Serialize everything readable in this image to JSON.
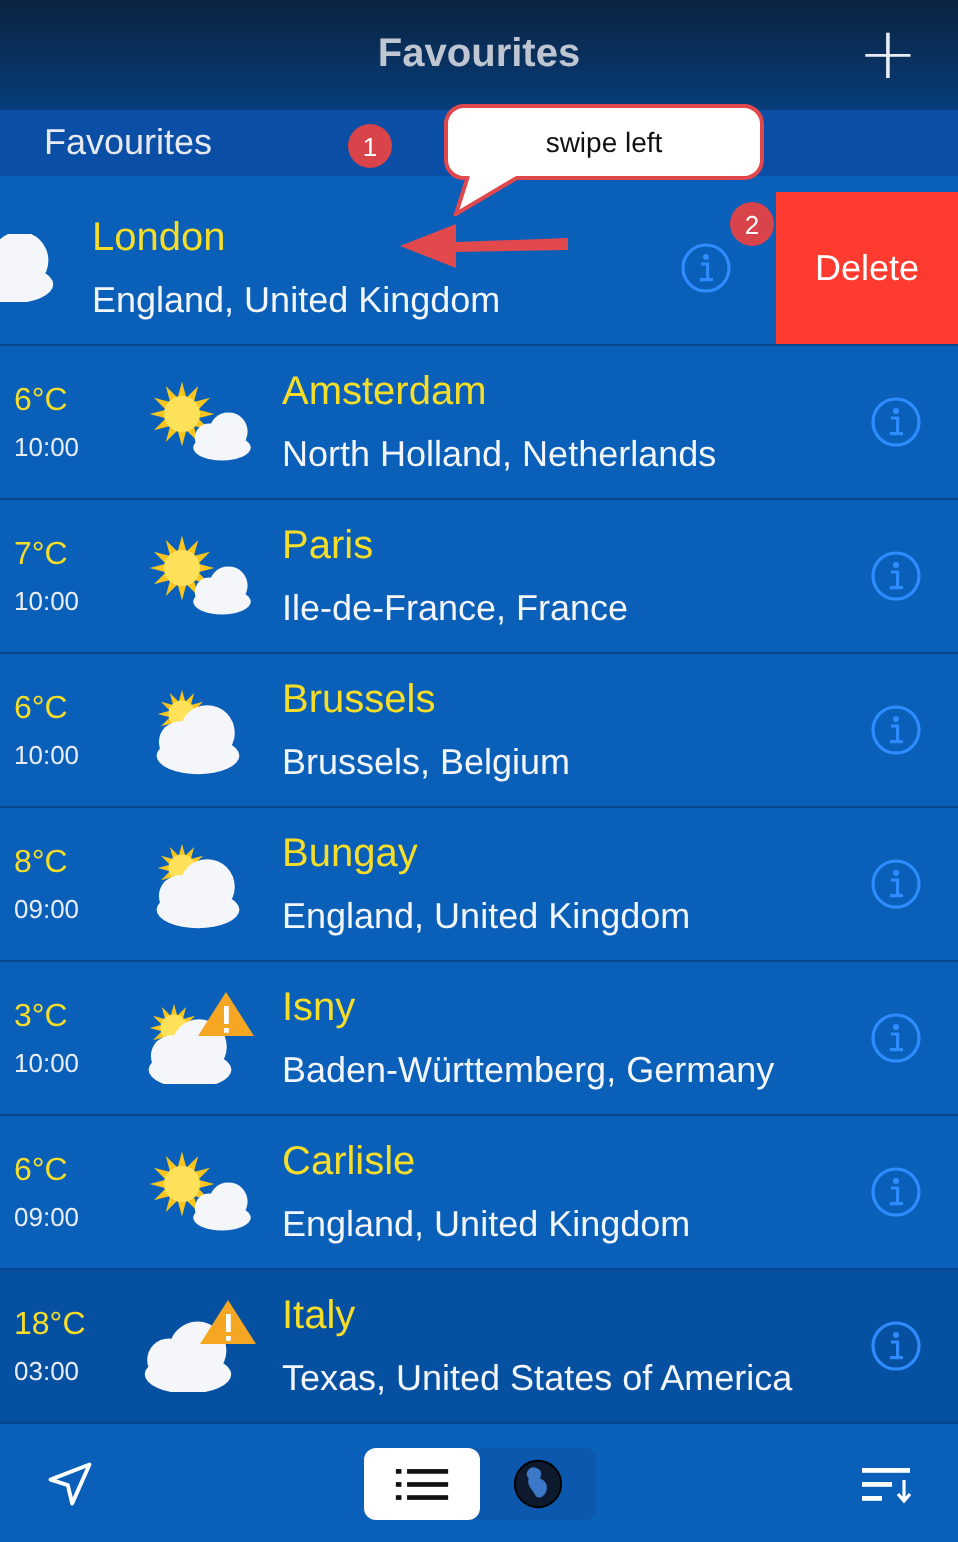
{
  "header": {
    "title": "Favourites",
    "add_label": "+"
  },
  "section": {
    "title": "Favourites"
  },
  "rows": [
    {
      "kind": "cloudy",
      "swiped": true,
      "name": "London",
      "region": "England, United Kingdom",
      "warning": false,
      "selected": false,
      "action": "Delete"
    },
    {
      "kind": "sunny",
      "swiped": false,
      "temp": "6°C",
      "time": "10:00",
      "name": "Amsterdam",
      "region": "North Holland, Netherlands",
      "warning": false,
      "selected": false
    },
    {
      "kind": "sunny",
      "swiped": false,
      "temp": "7°C",
      "time": "10:00",
      "name": "Paris",
      "region": "Ile-de-France, France",
      "warning": false,
      "selected": false
    },
    {
      "kind": "partly",
      "swiped": false,
      "temp": "6°C",
      "time": "10:00",
      "name": "Brussels",
      "region": "Brussels, Belgium",
      "warning": false,
      "selected": false
    },
    {
      "kind": "partly",
      "swiped": false,
      "temp": "8°C",
      "time": "09:00",
      "name": "Bungay",
      "region": "England, United Kingdom",
      "warning": false,
      "selected": false
    },
    {
      "kind": "partly",
      "swiped": false,
      "temp": "3°C",
      "time": "10:00",
      "name": "Isny",
      "region": "Baden-Württemberg, Germany",
      "warning": true,
      "selected": false
    },
    {
      "kind": "sunny",
      "swiped": false,
      "temp": "6°C",
      "time": "09:00",
      "name": "Carlisle",
      "region": "England, United Kingdom",
      "warning": false,
      "selected": false
    },
    {
      "kind": "cloudy",
      "swiped": false,
      "temp": "18°C",
      "time": "03:00",
      "name": "Italy",
      "region": "Texas, United States of America",
      "warning": true,
      "selected": true
    }
  ],
  "view_tabs": [
    {
      "kind": "list",
      "selected": true
    },
    {
      "kind": "globe",
      "selected": false
    }
  ],
  "annotations": {
    "callout": "swipe left",
    "steps": [
      "1",
      "2"
    ]
  }
}
